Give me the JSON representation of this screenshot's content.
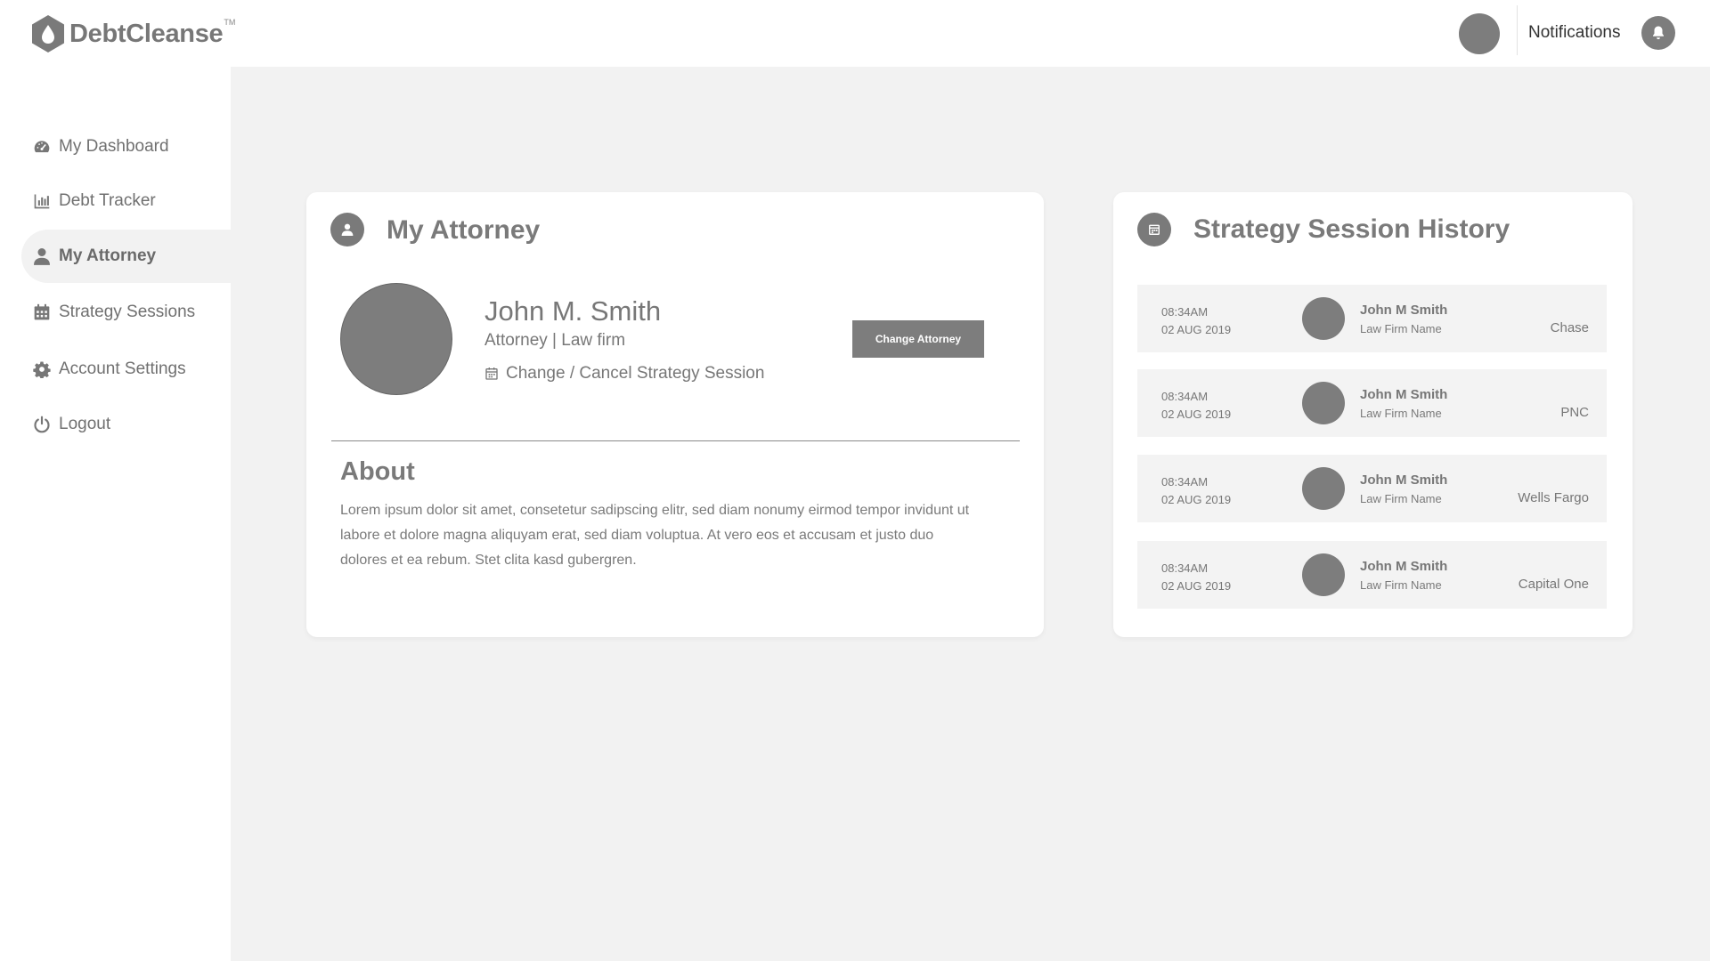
{
  "brand": {
    "name": "DebtCleanse",
    "tm": "TM"
  },
  "topbar": {
    "notifications_label": "Notifications"
  },
  "sidebar": {
    "items": [
      {
        "label": "My Dashboard",
        "icon": "dashboard-icon"
      },
      {
        "label": "Debt Tracker",
        "icon": "bar-chart-icon"
      },
      {
        "label": "My Attorney",
        "icon": "user-icon",
        "active": true
      },
      {
        "label": "Strategy Sessions",
        "icon": "calendar-icon"
      },
      {
        "label": "Account Settings",
        "icon": "gear-icon"
      },
      {
        "label": "Logout",
        "icon": "power-icon"
      }
    ]
  },
  "attorney": {
    "title": "My Attorney",
    "name": "John M. Smith",
    "role": "Attorney | Law firm",
    "session_link": "Change / Cancel Strategy Session",
    "change_button": "Change Attorney",
    "about_title": "About",
    "about_text": "Lorem ipsum dolor sit amet, consetetur sadipscing elitr, sed diam nonumy eirmod tempor invidunt ut labore et dolore magna aliquyam erat, sed diam voluptua. At vero eos et accusam et justo duo dolores et ea rebum. Stet clita kasd gubergren."
  },
  "history": {
    "title": "Strategy Session History",
    "rows": [
      {
        "time": "08:34AM",
        "date": "02 AUG 2019",
        "name": "John M Smith",
        "firm": "Law Firm Name",
        "bank": "Chase"
      },
      {
        "time": "08:34AM",
        "date": "02 AUG 2019",
        "name": "John M Smith",
        "firm": "Law Firm Name",
        "bank": "PNC"
      },
      {
        "time": "08:34AM",
        "date": "02 AUG 2019",
        "name": "John M Smith",
        "firm": "Law Firm Name",
        "bank": "Wells Fargo"
      },
      {
        "time": "08:34AM",
        "date": "02 AUG 2019",
        "name": "John M Smith",
        "firm": "Law Firm Name",
        "bank": "Capital One"
      }
    ]
  },
  "colors": {
    "primary_gray": "#7d7d7d",
    "background": "#f2f2f2",
    "card": "#ffffff"
  }
}
